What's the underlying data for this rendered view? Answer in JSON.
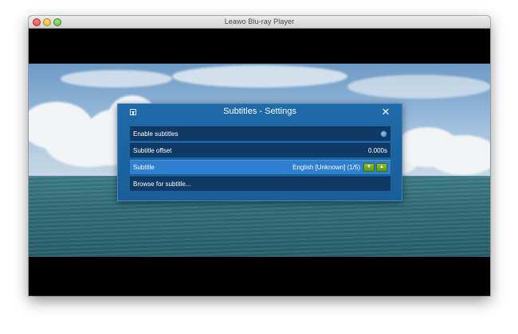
{
  "window": {
    "title": "Leawo Blu-ray Player"
  },
  "dialog": {
    "title": "Subtitles - Settings",
    "close_glyph": "✕",
    "rows": [
      {
        "label": "Enable subtitles"
      },
      {
        "label": "Subtitle offset",
        "value": "0.000s"
      },
      {
        "label": "Subtitle",
        "value": "English [Unknown] (1/5)",
        "down_glyph": "▼",
        "up_glyph": "▲"
      },
      {
        "label": "Browse for subtitle..."
      }
    ]
  },
  "colors": {
    "dialog_bg": "#1e6aa8",
    "row_bg": "#0f3a66",
    "row_selected_bg": "#2f7fd1",
    "arrow_button": "#7bb02c"
  }
}
